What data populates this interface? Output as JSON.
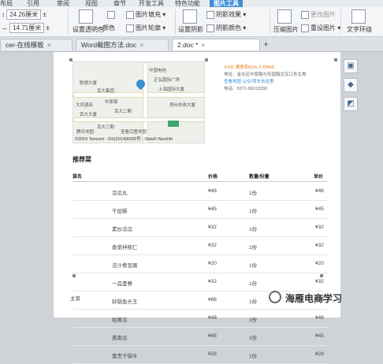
{
  "ribbon_tabs": [
    "布局",
    "引用",
    "审阅",
    "视图",
    "章节",
    "开发工具",
    "特色功能",
    "图片工具"
  ],
  "ribbon": {
    "height_value": "24.26厘米",
    "width_value": "14.71厘米",
    "set_transparent": "设置透明色",
    "color": "颜色",
    "picture_fill": "图片填充",
    "picture_outline": "图片轮廓",
    "set_shadow": "设置阴影",
    "shadow_effect": "阴影效果",
    "shadow_color": "阴影颜色",
    "compress": "压缩图片",
    "change_picture": "更改图片",
    "reset_picture": "重设图片",
    "text_wrap": "文字环绕"
  },
  "doc_tabs": [
    {
      "label": "cer-在线模板",
      "active": false
    },
    {
      "label": "Word截图方法.doc",
      "active": false
    },
    {
      "label": "2.doc *",
      "active": true
    }
  ],
  "map": {
    "labels": [
      "中国电信",
      "联想大厦",
      "百大集团",
      "大凤酒店",
      "中原路",
      "百大二期",
      "上海国际大厦",
      "正弘国际广场",
      "郑州市政大厦",
      "百大大厦",
      "百大三期",
      "查看完整地图",
      "腾讯地图"
    ],
    "copyright": "©2016 Tencent - GS(2014)6026号 - Data© NavInfo"
  },
  "info": {
    "rating": "4.6分  满意率81%  人均¥49",
    "address": "地址：金水区中原路与花园路交叉口东北角",
    "links": "查看地图   公交/驾车去这里",
    "phone": "电话：0371-86013338"
  },
  "section_title": "推荐菜",
  "table": {
    "headers": [
      "菜名",
      "价格",
      "数量/份量",
      "单价"
    ],
    "rows": [
      {
        "name": "凉瓜丸",
        "price": "¥46",
        "qty": "1份",
        "price2": "¥46"
      },
      {
        "name": "千层糕",
        "price": "¥45",
        "qty": "1份",
        "price2": "¥45"
      },
      {
        "name": "素炒凉瓜",
        "price": "¥32",
        "qty": "1份",
        "price2": "¥32"
      },
      {
        "name": "香菜拌核仁",
        "price": "¥32",
        "qty": "1份",
        "price2": "¥32"
      },
      {
        "name": "法汁煮豆腐",
        "price": "¥20",
        "qty": "1份",
        "price2": "¥20"
      },
      {
        "name": "一品里脊",
        "price": "¥32",
        "qty": "1份",
        "price2": "¥32"
      },
      {
        "name": "砂锅鱼头王",
        "price": "¥88",
        "qty": "1份",
        "price2": "¥88"
      },
      {
        "name": "拍黄瓜",
        "price": "¥48",
        "qty": "1份",
        "price2": "¥48"
      },
      {
        "name": "蒸南瓜",
        "price": "¥45",
        "qty": "1份",
        "price2": "¥45"
      },
      {
        "name": "富贵干锅牛",
        "price": "¥28",
        "qty": "1份",
        "price2": "¥28"
      }
    ],
    "category": "主菜"
  },
  "right_tools": [
    "layout-icon",
    "picture-icon",
    "crop-icon"
  ],
  "watermark": "海雁电商学习"
}
